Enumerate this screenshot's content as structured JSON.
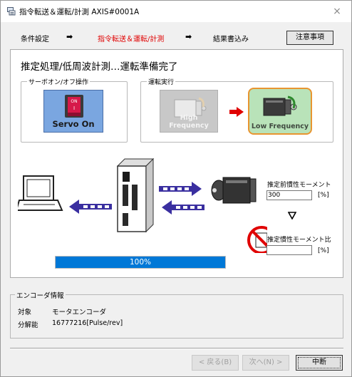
{
  "window": {
    "title": "指令転送＆運転/計測 AXIS#0001A",
    "close_glyph": "×"
  },
  "steps": {
    "items": [
      "条件設定",
      "指令転送＆運転/計測",
      "結果書込み"
    ],
    "arrow": "➡",
    "notice_label": "注意事項"
  },
  "status": "推定処理/低周波計測…運転準備完了",
  "servo_group": {
    "label": "サーボオン/オフ操作",
    "switch_on": "ON",
    "switch_mark": "I",
    "button_label": "Servo On"
  },
  "run_group": {
    "label": "運転実行",
    "high_label": "High Frequency",
    "low_label": "Low Frequency"
  },
  "estimate": {
    "inertia_label": "推定前慣性モーメント",
    "inertia_value": "300",
    "inertia_unit": "[%]",
    "ratio_label": "推定慣性モーメント比",
    "ratio_value": "",
    "ratio_unit": "[%]"
  },
  "progress": {
    "percent": 100,
    "label": "100%"
  },
  "encoder": {
    "title": "エンコーダ情報",
    "target_label": "対象",
    "target_value": "モータエンコーダ",
    "resolution_label": "分解能",
    "resolution_value": "16777216[Pulse/rev]"
  },
  "buttons": {
    "back": "< 戻る(B)",
    "next": "次へ(N) >",
    "cancel": "中断"
  },
  "colors": {
    "accent_red": "#e00000",
    "highlight_orange": "#e89530",
    "progress_blue": "#0078d7",
    "arrow_purple": "#3a2fa0"
  }
}
